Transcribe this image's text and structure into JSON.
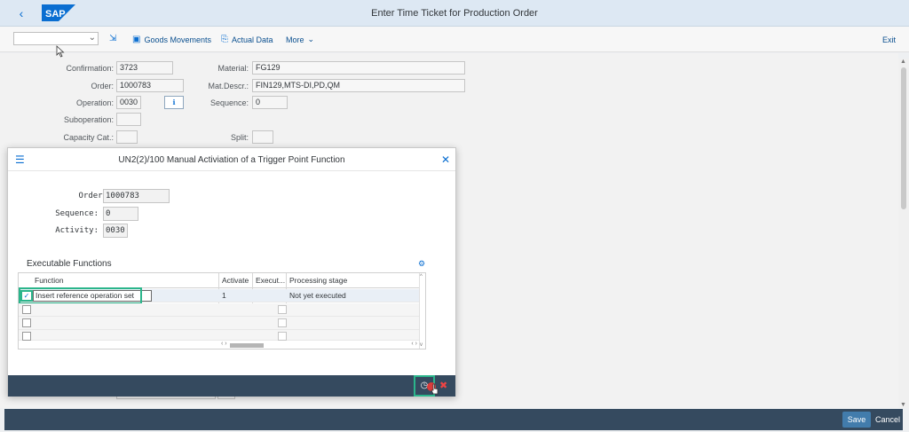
{
  "shell": {
    "title": "Enter Time Ticket for Production Order",
    "logo_text": "SAP",
    "back": "‹"
  },
  "toolbar": {
    "goods_movements": "Goods Movements",
    "actual_data": "Actual Data",
    "more": "More",
    "exit": "Exit"
  },
  "form": {
    "confirmation_label": "Confirmation:",
    "confirmation_value": "3723",
    "order_label": "Order:",
    "order_value": "1000783",
    "operation_label": "Operation:",
    "operation_value": "0030",
    "suboperation_label": "Suboperation:",
    "capacity_label": "Capacity Cat.:",
    "material_label": "Material:",
    "material_value": "FG129",
    "matdescr_label": "Mat.Descr.:",
    "matdescr_value": "FIN129,MTS-DI,PD,QM",
    "sequence_label": "Sequence:",
    "sequence_value": "0",
    "split_label": "Split:"
  },
  "dialog": {
    "title": "UN2(2)/100 Manual Activiation of a Trigger Point Function",
    "order_label": "Order:",
    "order_value": "1000783",
    "sequence_label": "Sequence:",
    "sequence_value": "0",
    "activity_label": "Activity:",
    "activity_value": "0030",
    "section_title": "Executable Functions",
    "table": {
      "headers": [
        "Function",
        "Activate",
        "Execut...",
        "Processing stage"
      ],
      "rows": [
        {
          "function": "Insert reference operation set",
          "activate": "1",
          "stage": "Not yet executed"
        }
      ]
    }
  },
  "footer": {
    "save": "Save",
    "cancel": "Cancel"
  },
  "colors": {
    "shell_bg": "#dde8f3",
    "footer_bg": "#354a5f",
    "accent": "#0a6ed1",
    "highlight": "#2bb58b"
  }
}
